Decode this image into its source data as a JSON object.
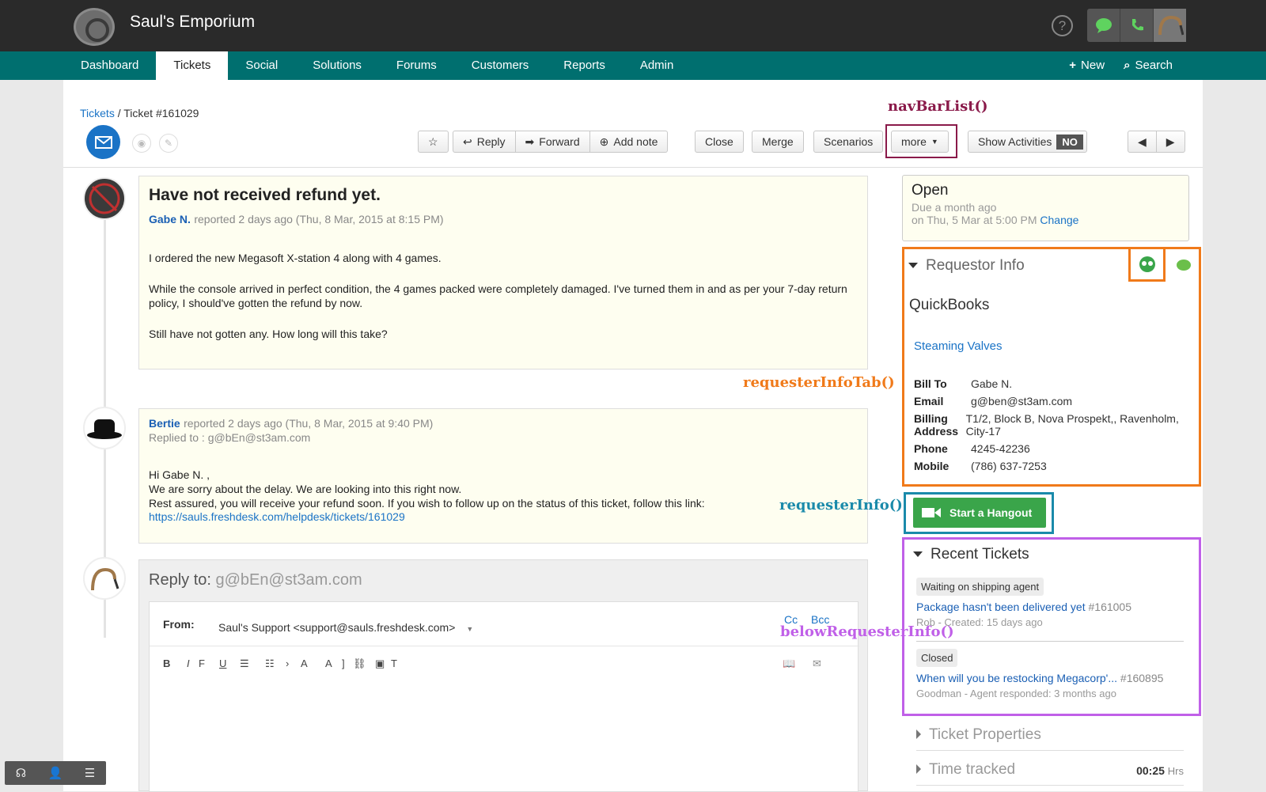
{
  "app": {
    "title": "Saul's Emporium",
    "help": "?"
  },
  "nav": {
    "tabs": [
      "Dashboard",
      "Tickets",
      "Social",
      "Solutions",
      "Forums",
      "Customers",
      "Reports",
      "Admin"
    ],
    "active": "Tickets",
    "new_label": "New",
    "search_label": "Search"
  },
  "breadcrumb": {
    "root": "Tickets",
    "sep": "/",
    "current": "Ticket #161029"
  },
  "toolbar": {
    "reply": "Reply",
    "forward": "Forward",
    "add_note": "Add note",
    "close": "Close",
    "merge": "Merge",
    "scenarios": "Scenarios",
    "more": "more",
    "show_activities": "Show Activities",
    "activities_toggle": "NO"
  },
  "ticket": {
    "subject": "Have not received refund yet.",
    "author": "Gabe N.",
    "meta": "reported 2 days ago (Thu, 8 Mar, 2015 at 8:15 PM)",
    "body": [
      "I ordered the new Megasoft X-station 4 along with 4 games.",
      "While the console arrived in perfect condition, the 4 games packed were completely damaged. I've turned them in and as per your 7-day return policy, I should've gotten the refund by now.",
      "Still have not gotten any. How long will this take?"
    ]
  },
  "reply_msg": {
    "author": "Bertie",
    "meta": "reported 2 days ago (Thu, 8 Mar, 2015 at 9:40 PM)",
    "replied_to": "Replied to : g@bEn@st3am.com",
    "lines": [
      "Hi Gabe N. ,",
      "We are sorry about the delay. We are looking into this right now.",
      "Rest assured, you will receive your refund soon. If you wish to follow up on the status of this ticket, follow this link:"
    ],
    "link": "https://sauls.freshdesk.com/helpdesk/tickets/161029"
  },
  "compose": {
    "reply_to_label": "Reply to:",
    "reply_to": "g@bEn@st3am.com",
    "from_label": "From:",
    "from_value": "Saul's Support <support@sauls.freshdesk.com>",
    "cc": "Cc",
    "bcc": "Bcc"
  },
  "status": {
    "state": "Open",
    "due": "Due a month ago",
    "due_date": "on Thu, 5 Mar at 5:00 PM",
    "change": "Change"
  },
  "requestor": {
    "heading": "Requestor Info",
    "company": "QuickBooks",
    "link": "Steaming Valves",
    "fields": [
      {
        "label": "Bill To",
        "value": "Gabe N."
      },
      {
        "label": "Email",
        "value": "g@ben@st3am.com"
      },
      {
        "label": "Billing Address",
        "value": "T1/2, Block B, Nova Prospekt,, Ravenholm, City-17"
      },
      {
        "label": "Phone",
        "value": "4245-42236"
      },
      {
        "label": "Mobile",
        "value": "(786) 637-7253"
      }
    ]
  },
  "hangout": {
    "label": "Start a Hangout"
  },
  "recent": {
    "heading": "Recent Tickets",
    "items": [
      {
        "tag": "Waiting on shipping agent",
        "title": "Package hasn't been delivered yet",
        "id": "#161005",
        "sub": "Rob - Created: 15 days ago"
      },
      {
        "tag": "Closed",
        "title": "When will you be restocking Megacorp'...",
        "id": "#160895",
        "sub": "Goodman - Agent responded: 3 months ago"
      }
    ]
  },
  "collapsed": {
    "props": "Ticket Properties",
    "time": "Time tracked",
    "time_value": "00:25",
    "time_unit": "Hrs"
  },
  "annotations": {
    "nav": "navBarList()",
    "tab": "requesterInfoTab()",
    "info": "requesterInfo()",
    "below": "belowRequesterInfo()",
    "colors": {
      "nav": "#8a1a4a",
      "tab": "#f07a1a",
      "info": "#1a8aaa",
      "below": "#c060e8"
    }
  }
}
